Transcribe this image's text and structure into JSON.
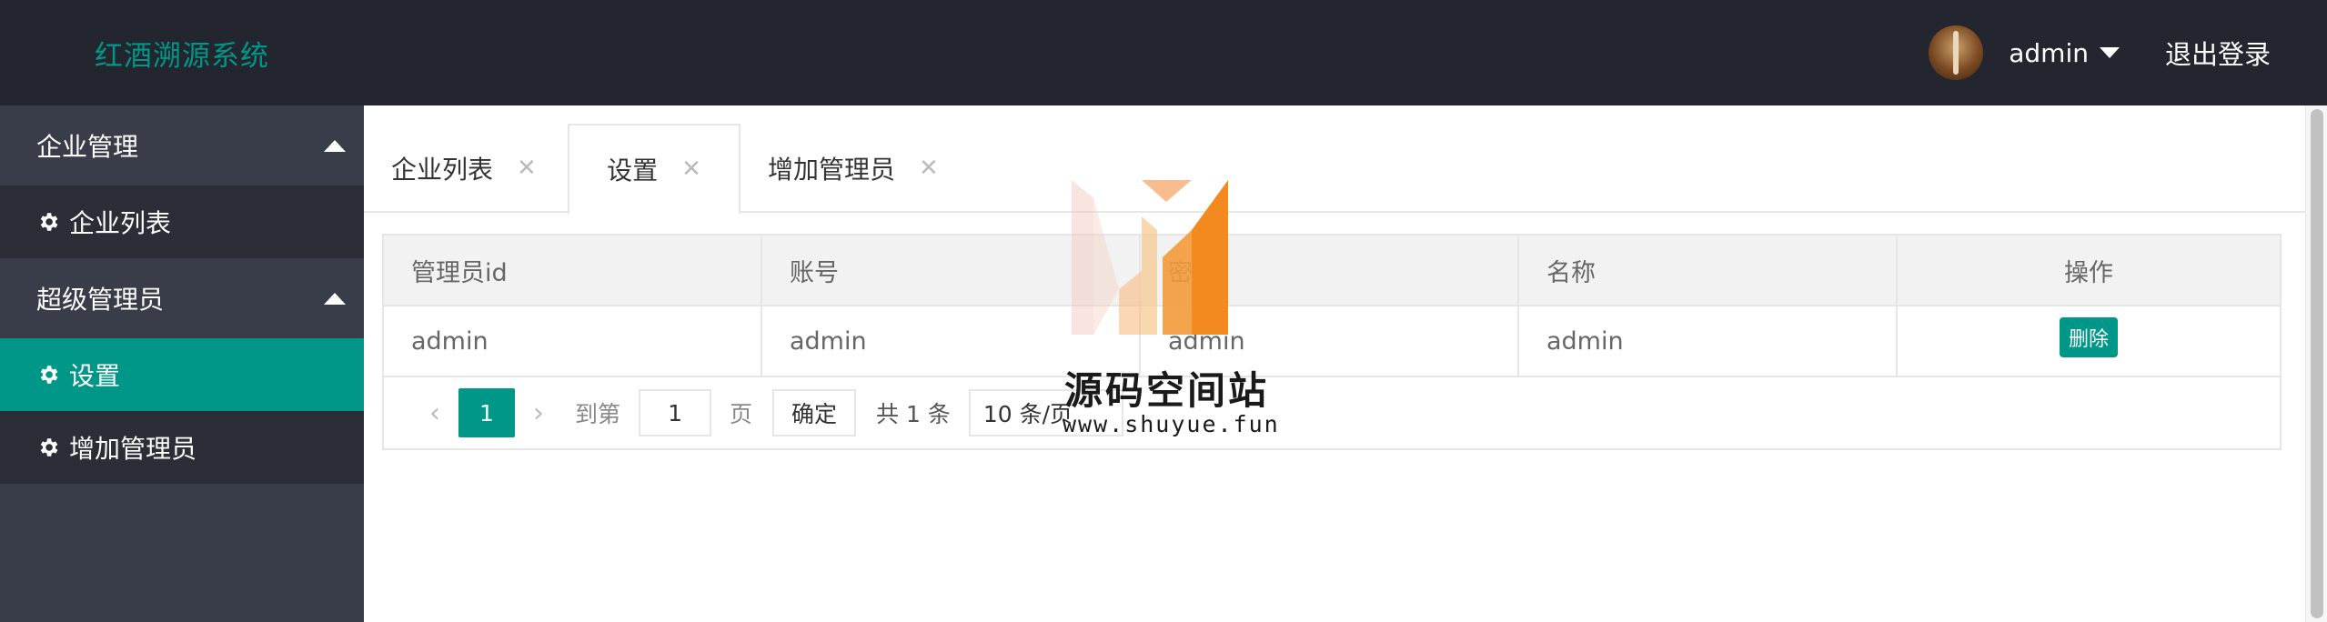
{
  "app": {
    "title": "红酒溯源系统"
  },
  "header": {
    "username": "admin",
    "logout_label": "退出登录"
  },
  "sidebar": {
    "groups": [
      {
        "label": "企业管理",
        "items": [
          {
            "label": "企业列表"
          }
        ]
      },
      {
        "label": "超级管理员",
        "items": [
          {
            "label": "设置",
            "active": true
          },
          {
            "label": "增加管理员"
          }
        ]
      }
    ]
  },
  "tabs": [
    {
      "label": "企业列表"
    },
    {
      "label": "设置",
      "active": true
    },
    {
      "label": "增加管理员"
    }
  ],
  "table": {
    "columns": [
      "管理员id",
      "账号",
      "密码",
      "名称",
      "操作"
    ],
    "rows": [
      {
        "id": "admin",
        "account": "admin",
        "password": "admin",
        "name": "admin",
        "action": "删除"
      }
    ]
  },
  "pager": {
    "current_page": "1",
    "goto_label": "到第",
    "goto_value": "1",
    "page_label": "页",
    "confirm_label": "确定",
    "total_label": "共 1 条",
    "page_size": "10 条/页"
  },
  "watermark": {
    "title": "源码空间站",
    "url": "www.shuyue.fun"
  },
  "colors": {
    "accent": "#009688",
    "header_bg": "#23262e",
    "sidebar_bg": "#393d49"
  }
}
